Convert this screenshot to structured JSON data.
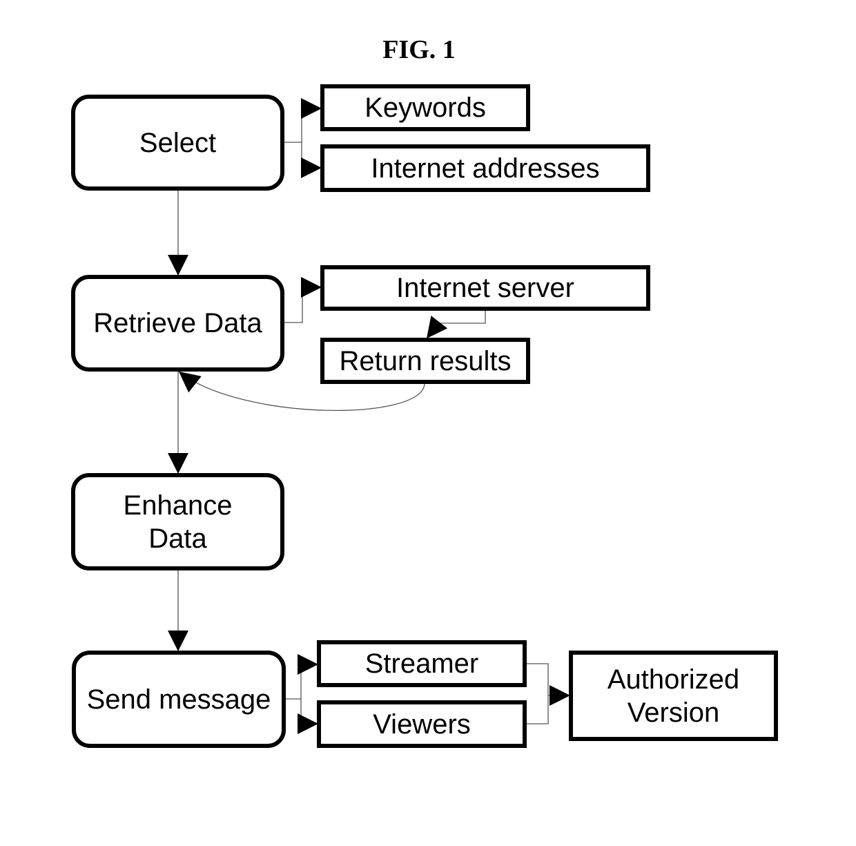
{
  "figure": {
    "title": "FIG. 1"
  },
  "nodes": {
    "select": "Select",
    "retrieve_data": "Retrieve Data",
    "enhance_data": "Enhance\nData",
    "send_message": "Send message",
    "keywords": "Keywords",
    "internet_addresses": "Internet addresses",
    "internet_server": "Internet server",
    "return_results": "Return results",
    "streamer": "Streamer",
    "viewers": "Viewers",
    "authorized_version": "Authorized\nVersion"
  },
  "edges": [
    {
      "from": "Select",
      "to": "Keywords"
    },
    {
      "from": "Select",
      "to": "Internet addresses"
    },
    {
      "from": "Select",
      "to": "Retrieve Data"
    },
    {
      "from": "Retrieve Data",
      "to": "Internet server"
    },
    {
      "from": "Internet server",
      "to": "Return results"
    },
    {
      "from": "Return results",
      "to": "Retrieve Data"
    },
    {
      "from": "Retrieve Data",
      "to": "Enhance Data"
    },
    {
      "from": "Enhance Data",
      "to": "Send message"
    },
    {
      "from": "Send message",
      "to": "Streamer"
    },
    {
      "from": "Send message",
      "to": "Viewers"
    },
    {
      "from": "Streamer",
      "to": "Authorized Version"
    },
    {
      "from": "Viewers",
      "to": "Authorized Version"
    }
  ]
}
